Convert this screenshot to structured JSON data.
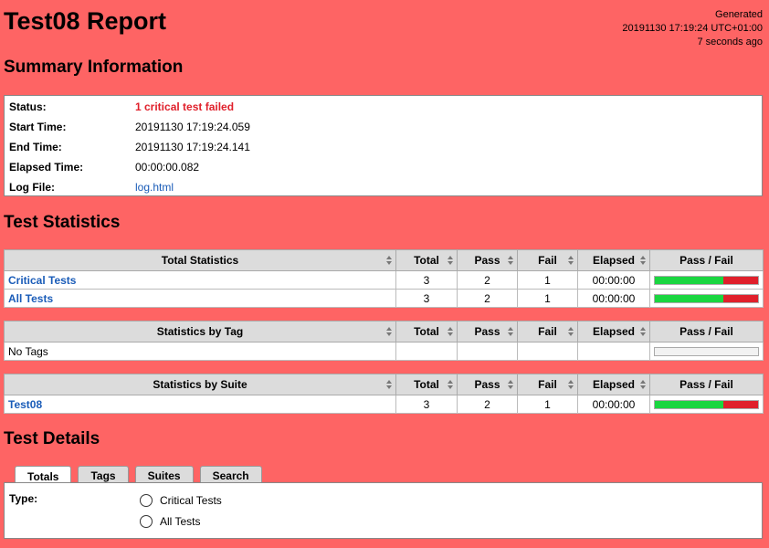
{
  "header": {
    "title": "Test08 Report",
    "generated_label": "Generated",
    "generated_time": "20191130 17:19:24 UTC+01:00",
    "generated_ago": "7 seconds ago"
  },
  "summary": {
    "heading": "Summary Information",
    "rows": [
      {
        "label": "Status:",
        "value": "1 critical test failed"
      },
      {
        "label": "Start Time:",
        "value": "20191130 17:19:24.059"
      },
      {
        "label": "End Time:",
        "value": "20191130 17:19:24.141"
      },
      {
        "label": "Elapsed Time:",
        "value": "00:00:00.082"
      },
      {
        "label": "Log File:",
        "value": "log.html"
      }
    ]
  },
  "statistics": {
    "heading": "Test Statistics",
    "columns": [
      "Total",
      "Pass",
      "Fail",
      "Elapsed",
      "Pass / Fail"
    ],
    "total": {
      "title": "Total Statistics",
      "rows": [
        {
          "name": "Critical Tests",
          "total": "3",
          "pass": "2",
          "fail": "1",
          "elapsed": "00:00:00",
          "pass_ratio": 0.667
        },
        {
          "name": "All Tests",
          "total": "3",
          "pass": "2",
          "fail": "1",
          "elapsed": "00:00:00",
          "pass_ratio": 0.667
        }
      ]
    },
    "tag": {
      "title": "Statistics by Tag",
      "rows": [
        {
          "name": "No Tags",
          "total": "",
          "pass": "",
          "fail": "",
          "elapsed": ""
        }
      ]
    },
    "suite": {
      "title": "Statistics by Suite",
      "rows": [
        {
          "name": "Test08",
          "total": "3",
          "pass": "2",
          "fail": "1",
          "elapsed": "00:00:00",
          "pass_ratio": 0.667
        }
      ]
    }
  },
  "details": {
    "heading": "Test Details",
    "tabs": [
      "Totals",
      "Tags",
      "Suites",
      "Search"
    ],
    "type_label": "Type:",
    "options": [
      "Critical Tests",
      "All Tests"
    ]
  },
  "colors": {
    "background": "#fe6464",
    "pass": "#1ad640",
    "fail": "#e0202b",
    "link": "#1a5cb8"
  }
}
